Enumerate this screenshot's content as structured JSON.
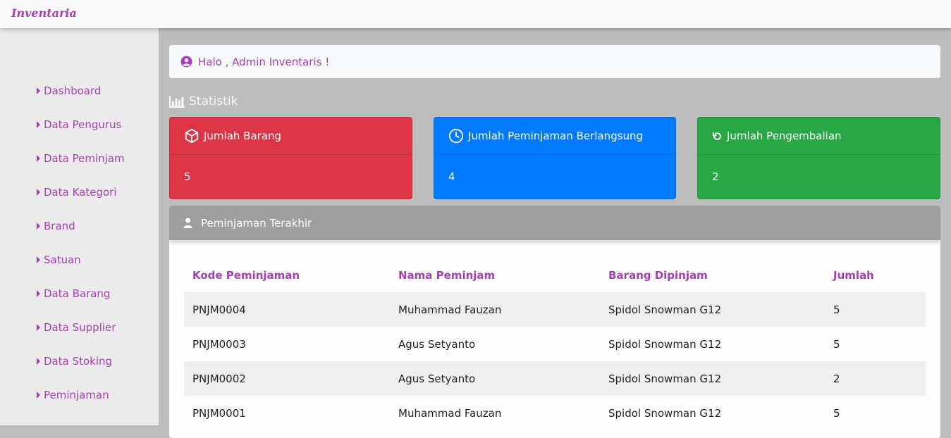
{
  "app": {
    "title": "Inventaria"
  },
  "sidebar": {
    "items": [
      {
        "label": "Dashboard"
      },
      {
        "label": "Data Pengurus"
      },
      {
        "label": "Data Peminjam"
      },
      {
        "label": "Data Kategori"
      },
      {
        "label": "Brand"
      },
      {
        "label": "Satuan"
      },
      {
        "label": "Data Barang"
      },
      {
        "label": "Data Supplier"
      },
      {
        "label": "Data Stoking"
      },
      {
        "label": "Peminjaman"
      }
    ]
  },
  "greeting": {
    "text": "Halo , Admin Inventaris !",
    "icon": "user-circle-icon"
  },
  "stats": {
    "title": "Statistik",
    "icon": "bar-chart-icon",
    "cards": [
      {
        "label": "Jumlah Barang",
        "value": "5",
        "icon": "box-icon",
        "color": "#dc3545"
      },
      {
        "label": "Jumlah Peminjaman Berlangsung",
        "value": "4",
        "icon": "clock-icon",
        "color": "#007bff"
      },
      {
        "label": "Jumlah Pengembalian",
        "value": "2",
        "icon": "undo-icon",
        "color": "#28a745"
      }
    ]
  },
  "recent": {
    "title": "Peminjaman Terakhir",
    "icon": "user-icon",
    "columns": [
      "Kode Peminjaman",
      "Nama Peminjam",
      "Barang Dipinjam",
      "Jumlah"
    ],
    "rows": [
      [
        "PNJM0004",
        "Muhammad Fauzan",
        "Spidol Snowman G12",
        "5"
      ],
      [
        "PNJM0003",
        "Agus Setyanto",
        "Spidol Snowman G12",
        "5"
      ],
      [
        "PNJM0002",
        "Agus Setyanto",
        "Spidol Snowman G12",
        "2"
      ],
      [
        "PNJM0001",
        "Muhammad Fauzan",
        "Spidol Snowman G12",
        "5"
      ]
    ]
  },
  "colors": {
    "accent": "#a63fb4"
  }
}
